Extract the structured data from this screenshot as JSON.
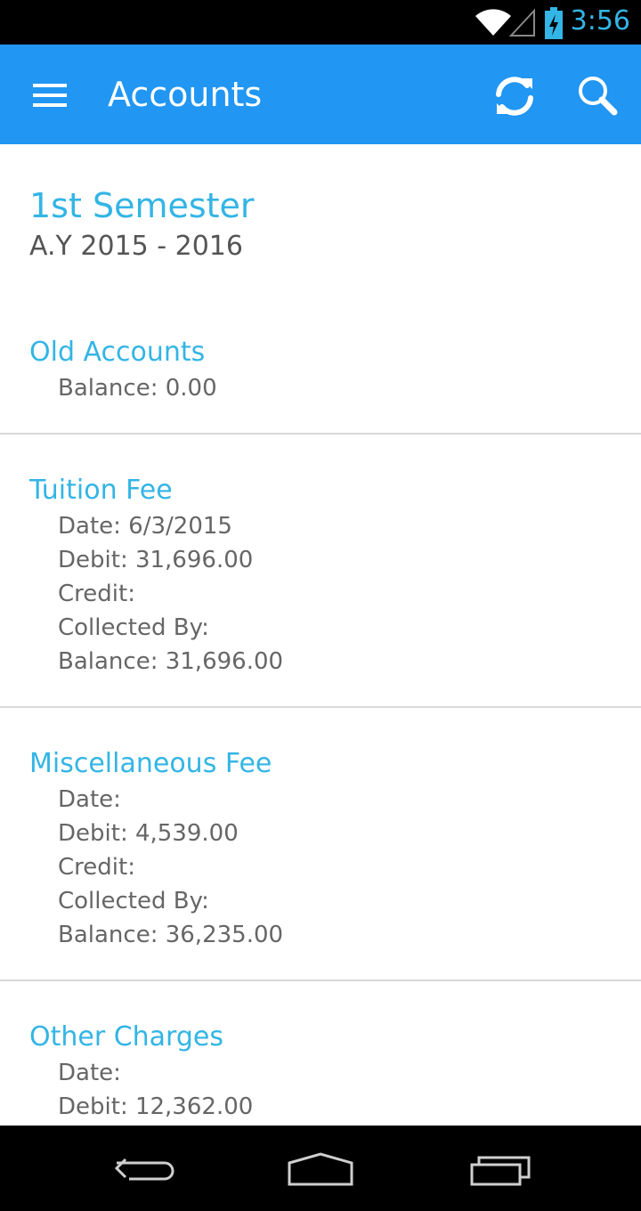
{
  "status_bar": {
    "time": "3:56",
    "icons": [
      "wifi-icon",
      "cell-signal-icon",
      "battery-charging-icon"
    ],
    "accent_color": "#33b5e5"
  },
  "app_bar": {
    "title": "Accounts",
    "background_color": "#2196f3",
    "icons": [
      "menu-icon",
      "refresh-icon",
      "search-icon"
    ]
  },
  "semester": {
    "title": "1st Semester",
    "academic_year": "A.Y 2015 - 2016"
  },
  "accounts": [
    {
      "name": "Old Accounts",
      "details": [
        "Balance: 0.00"
      ]
    },
    {
      "name": "Tuition Fee",
      "details": [
        "Date: 6/3/2015",
        "Debit: 31,696.00",
        "Credit:",
        "Collected By:",
        "Balance: 31,696.00"
      ]
    },
    {
      "name": "Miscellaneous Fee",
      "details": [
        "Date:",
        "Debit: 4,539.00",
        "Credit:",
        "Collected By:",
        "Balance: 36,235.00"
      ]
    },
    {
      "name": "Other Charges",
      "details": [
        "Date:",
        "Debit: 12,362.00"
      ]
    }
  ],
  "nav_bar": {
    "buttons": [
      "back-icon",
      "home-icon",
      "recent-apps-icon"
    ]
  }
}
